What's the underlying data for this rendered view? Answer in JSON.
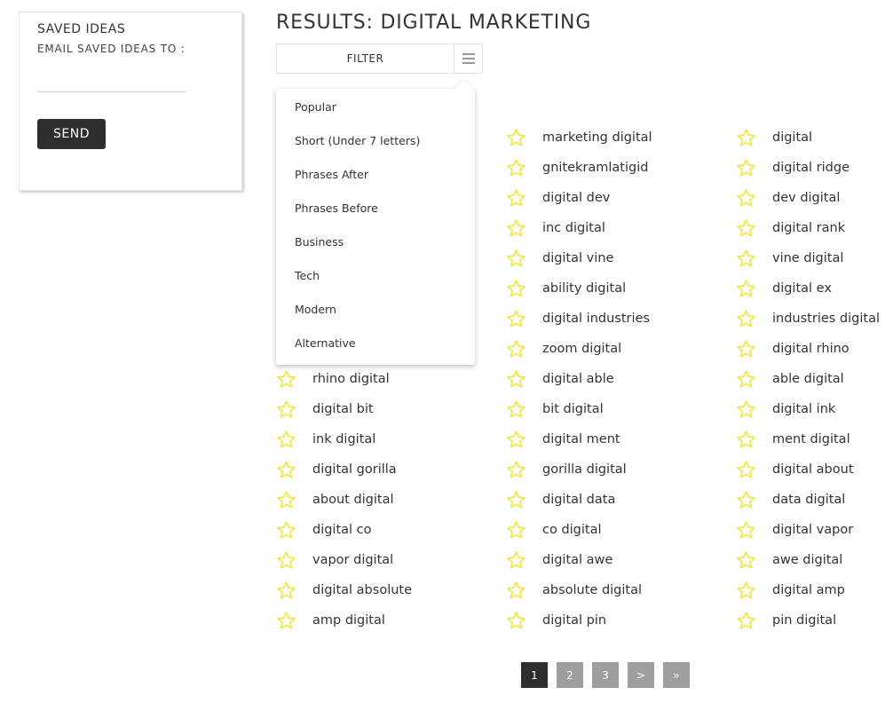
{
  "saved_ideas": {
    "title": "SAVED IDEAS",
    "email_label": "EMAIL SAVED IDEAS TO :",
    "email_value": "",
    "email_placeholder": "",
    "send_label": "SEND"
  },
  "header": {
    "title": "RESULTS: DIGITAL MARKETING"
  },
  "filter": {
    "label": "FILTER",
    "toggle_icon": "hamburger-menu-icon",
    "options": [
      "Popular",
      "Short (Under 7 letters)",
      "Phrases After",
      "Phrases Before",
      "Business",
      "Tech",
      "Modern",
      "Alternative"
    ]
  },
  "colors": {
    "star": "#f5e642",
    "dark": "#2e2e2e",
    "page_inactive": "#9e9e9e"
  },
  "results": {
    "star_icon": "star-outline-icon",
    "columns": [
      [
        "",
        "",
        "",
        "",
        "",
        "",
        "",
        "",
        "rhino digital",
        "digital bit",
        "ink digital",
        "digital gorilla",
        "about digital",
        "digital co",
        "vapor digital",
        "digital absolute",
        "amp digital"
      ],
      [
        "marketing digital",
        "gnitekramlatigid",
        "digital dev",
        "inc digital",
        "digital vine",
        "ability digital",
        "digital industries",
        "zoom digital",
        "digital able",
        "bit digital",
        "digital ment",
        "gorilla digital",
        "digital data",
        "co digital",
        "digital awe",
        "absolute digital",
        "digital pin"
      ],
      [
        "digital",
        "digital ridge",
        "dev digital",
        "digital rank",
        "vine digital",
        "digital ex",
        "industries digital",
        "digital rhino",
        "able digital",
        "digital ink",
        "ment digital",
        "digital about",
        "data digital",
        "digital vapor",
        "awe digital",
        "digital amp",
        "pin digital"
      ]
    ]
  },
  "pagination": {
    "pages": [
      "1",
      "2",
      "3",
      ">",
      "»"
    ],
    "active": "1"
  }
}
